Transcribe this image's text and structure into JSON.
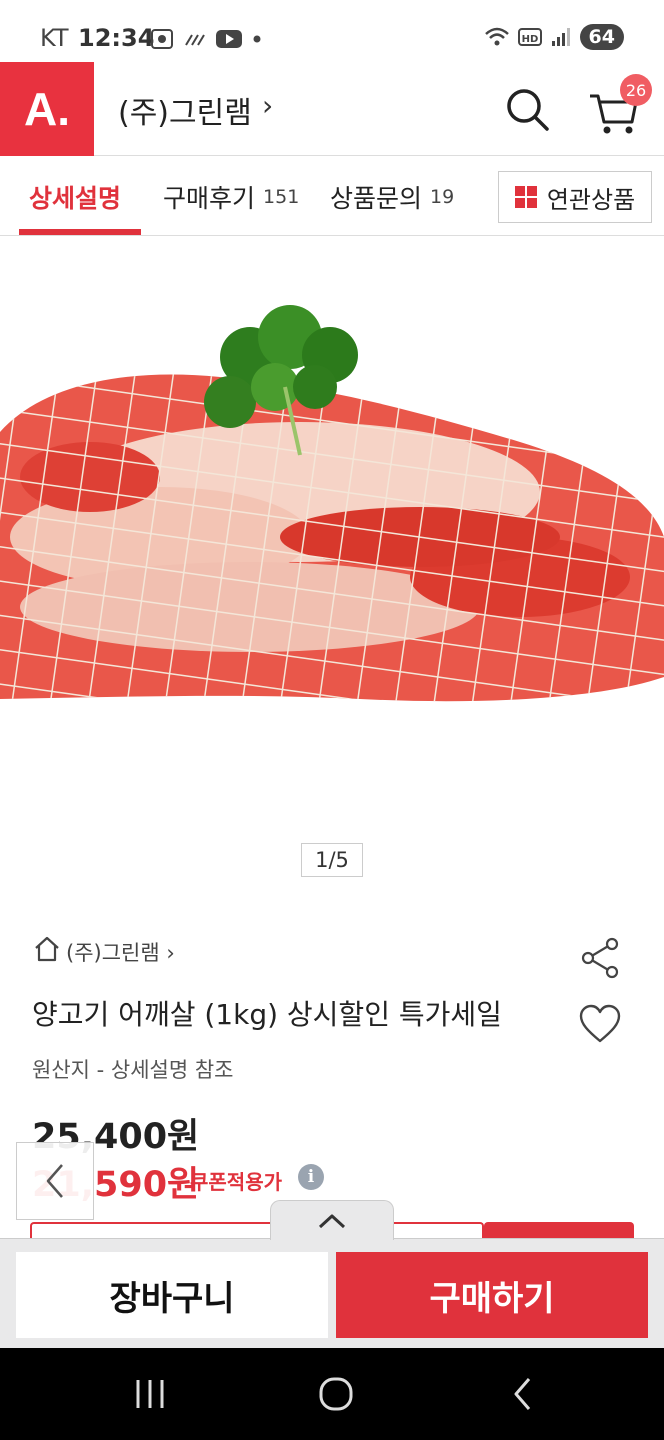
{
  "status_bar": {
    "carrier": "KT",
    "time": "12:34",
    "battery": "64",
    "network_label": "HD"
  },
  "header": {
    "logo_text": "A.",
    "store_title": "(주)그린램",
    "chevron": "›",
    "cart_count": "26"
  },
  "tabs": [
    {
      "label": "상세설명",
      "count": ""
    },
    {
      "label": "구매후기",
      "count": "151"
    },
    {
      "label": "상품문의",
      "count": "19"
    }
  ],
  "related_button": "연관상품",
  "gallery": {
    "counter": "1/5"
  },
  "product": {
    "seller": "(주)그린램 ›",
    "title": "양고기 어깨살 (1kg) 상시할인 특가세일",
    "origin": "원산지 - 상세설명 참조",
    "price_original": "25,400원",
    "price_coupon": "21,590원",
    "coupon_label": "쿠폰적용가",
    "info_symbol": "i"
  },
  "actions": {
    "cart_label": "장바구니",
    "buy_label": "구매하기"
  },
  "colors": {
    "brand": "#e0323c",
    "badge": "#f05d63"
  }
}
